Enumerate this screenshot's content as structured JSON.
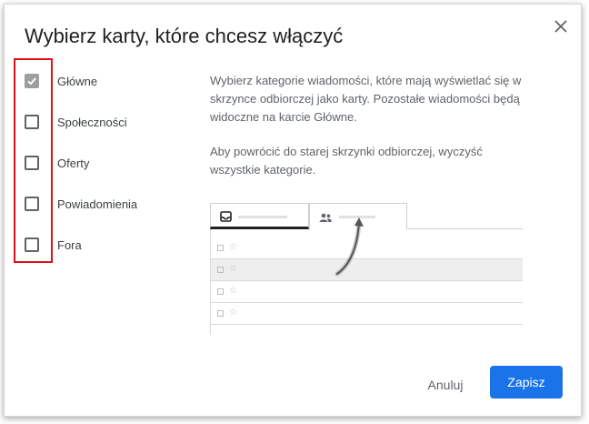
{
  "dialog": {
    "title": "Wybierz karty, które chcesz włączyć"
  },
  "categories": [
    {
      "label": "Główne",
      "checked": true
    },
    {
      "label": "Społeczności",
      "checked": false
    },
    {
      "label": "Oferty",
      "checked": false
    },
    {
      "label": "Powiadomienia",
      "checked": false
    },
    {
      "label": "Fora",
      "checked": false
    }
  ],
  "description": {
    "line1": "Wybierz kategorie wiadomości, które mają wyświetlać się w",
    "line2": "skrzynce odbiorczej jako karty. Pozostałe wiadomości będą",
    "line3": "widoczne na karcie Główne.",
    "line4": "Aby powrócić do starej skrzynki odbiorczej, wyczyść",
    "line5": "wszystkie kategorie."
  },
  "preview": {
    "tabs": [
      {
        "icon": "inbox-icon",
        "active": true
      },
      {
        "icon": "people-icon",
        "active": false
      }
    ],
    "rows": 4
  },
  "actions": {
    "cancel_label": "Anuluj",
    "save_label": "Zapisz"
  },
  "colors": {
    "primary": "#1a73e8",
    "highlight_border": "#e0101b",
    "checked_box": "#9e9e9e"
  }
}
